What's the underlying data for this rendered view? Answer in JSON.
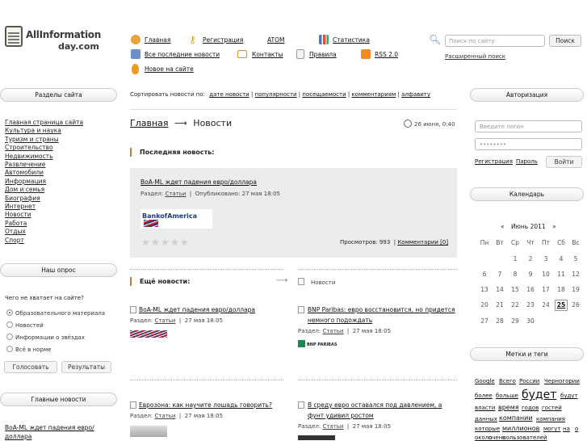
{
  "logo": {
    "line1": "AllInformation",
    "line2": "day.com"
  },
  "nav": {
    "home": "Главная",
    "register": "Регистрация",
    "atom": "ATOM",
    "stats": "Статистика",
    "all_news": "Все последние новости",
    "contacts": "Контакты",
    "rules": "Правила",
    "rss": "RSS 2.0",
    "new_on_site": "Новое на сайте"
  },
  "search": {
    "placeholder": "Поиск по сайту",
    "button": "Поиск",
    "advanced": "Расширенный поиск"
  },
  "sidebar": {
    "sections_title": "Разделы сайта",
    "items": [
      "Главная страница сайта",
      "Культура и наука",
      "Туризм и страны",
      "Строительство",
      "Недвижимость",
      "Развлечение",
      "Автомобили",
      "Информация",
      "Дом и семья",
      "Биография",
      "Интернет",
      "Новости",
      "Работа",
      "Отдых",
      "Спорт"
    ]
  },
  "poll": {
    "title": "Наш опрос",
    "question": "Чего не хватает на сайте?",
    "options": [
      "Образовательного материала",
      "Новостей",
      "Информации о звёздах",
      "Всё в норме"
    ],
    "vote": "Голосовать",
    "results": "Результаты"
  },
  "main_news": {
    "title": "Главные новости",
    "item": "BoA-ML ждет падения евро/доллара"
  },
  "sort": {
    "label": "Сортировать новости по:",
    "options": [
      "дате новости",
      "популярности",
      "посещаемости",
      "комментариям",
      "алфавиту"
    ]
  },
  "breadcrumb": {
    "home": "Главная",
    "arrow": "⟶",
    "current": "Новости",
    "date": "26 июня, 0:40"
  },
  "latest": {
    "heading": "Последняя новость:",
    "title": "BoA-ML ждет падения евро/доллара",
    "section_label": "Раздел:",
    "section": "Статьи",
    "published": "Опубликовано: 27 мая 18:05",
    "views": "Просмотров: 993",
    "comments": "Комментарии [0]",
    "logo_text": "BankofAmerica"
  },
  "more": {
    "heading": "Ещё новости:",
    "arrow": "⟶",
    "news_link": "Новости"
  },
  "items": [
    {
      "title": "BoA-ML ждет падения евро/доллара",
      "section": "Статьи",
      "date": "27 мая 18:05"
    },
    {
      "title": "BNP Paribas: евро восстановится, но придется немного подождать",
      "section": "Статьи",
      "date": "27 мая 18:05",
      "logo": "BNP PARIBAS"
    },
    {
      "title": "Еврозона: как научите лошадь говорить?",
      "section": "Статьи",
      "date": "27 мая 18:05"
    },
    {
      "title": "В среду евро оставался под давлением, а фунт удивил ростом",
      "section": "Статьи",
      "date": "27 мая 18:05"
    }
  ],
  "auth": {
    "title": "Авторизация",
    "login_placeholder": "Введите логин",
    "password_placeholder": "••••••••",
    "register": "Регистрация",
    "password": "Пароль",
    "login": "Войти"
  },
  "calendar": {
    "title": "Календарь",
    "month": "Июнь 2011",
    "prev": "«",
    "next": "»",
    "weekdays": [
      "Пн",
      "Вт",
      "Ср",
      "Чт",
      "Пт",
      "Сб",
      "Вс"
    ],
    "days": [
      "1",
      "2",
      "3",
      "4",
      "5",
      "6",
      "7",
      "8",
      "9",
      "10",
      "11",
      "12",
      "13",
      "14",
      "15",
      "16",
      "17",
      "18",
      "19",
      "20",
      "21",
      "22",
      "23",
      "24",
      "25",
      "26",
      "27",
      "28",
      "29",
      "30"
    ],
    "today": "25"
  },
  "tags": {
    "title": "Метки и теги",
    "list": [
      "Google",
      "Всего",
      "России",
      "Черногории",
      "более",
      "больше",
      "будет",
      "будут",
      "власти",
      "время",
      "годов",
      "гостей",
      "данных",
      "компании",
      "компания",
      "которые",
      "миллионов",
      "могут",
      "на",
      "о",
      "около",
      "очень",
      "пользователей"
    ]
  }
}
